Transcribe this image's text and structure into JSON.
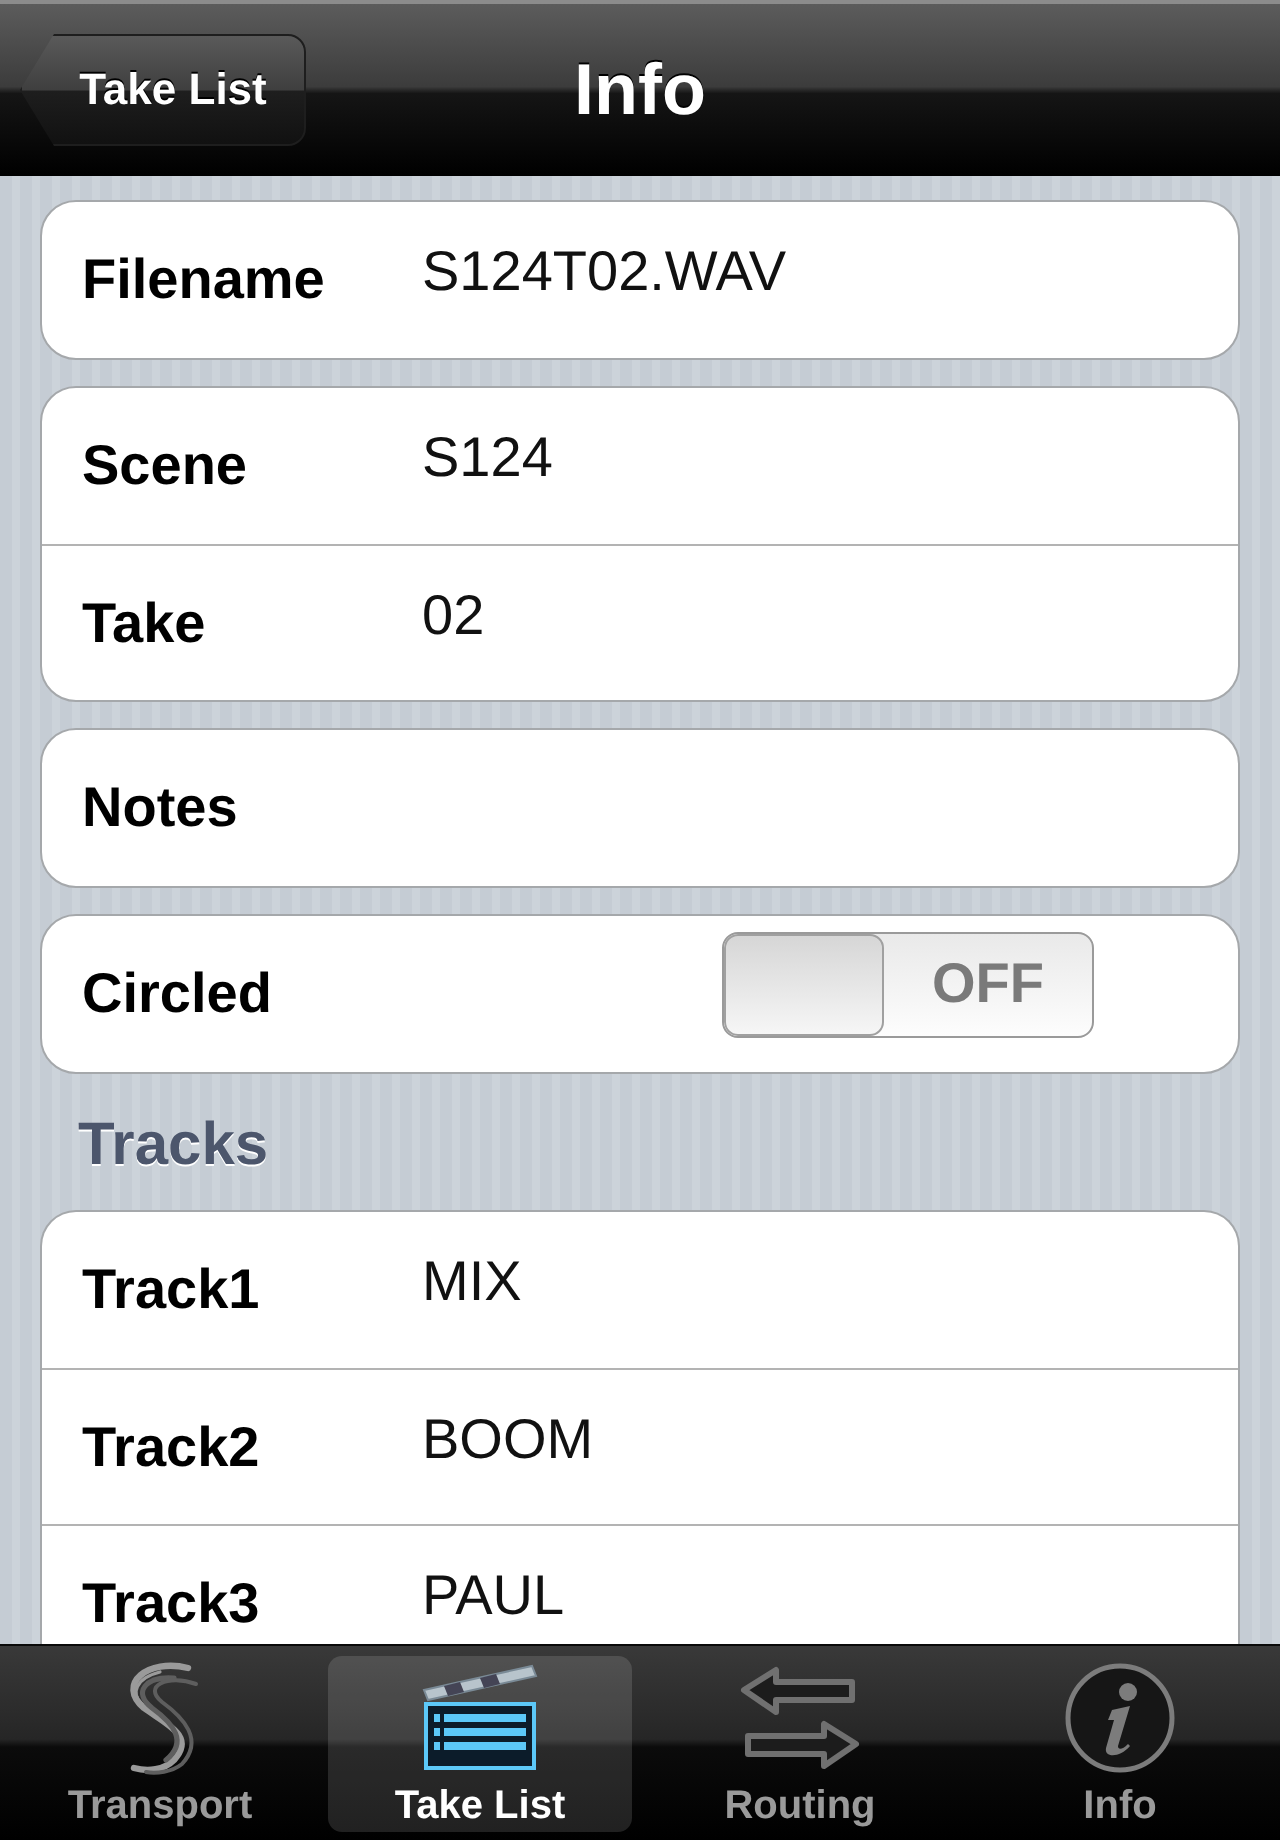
{
  "nav_bar": {
    "back_button": "Take List",
    "title": "Info"
  },
  "groups": [
    {
      "rows": [
        {
          "kind": "text",
          "label": "Filename",
          "value": "S124T02.WAV"
        }
      ]
    },
    {
      "rows": [
        {
          "kind": "text",
          "label": "Scene",
          "value": "S124"
        },
        {
          "kind": "text",
          "label": "Take",
          "value": "02"
        }
      ]
    },
    {
      "rows": [
        {
          "kind": "text",
          "label": "Notes"
        }
      ]
    },
    {
      "rows": [
        {
          "kind": "switch",
          "label": "Circled",
          "on": false,
          "switch_text": "OFF"
        }
      ]
    }
  ],
  "tracks_section": {
    "header": "Tracks",
    "rows": [
      {
        "kind": "text",
        "label": "Track1",
        "value": "MIX"
      },
      {
        "kind": "text",
        "label": "Track2",
        "value": "BOOM"
      },
      {
        "kind": "text",
        "label": "Track3",
        "value": "PAUL"
      }
    ]
  },
  "tab_bar": {
    "tabs": [
      {
        "label": "Transport",
        "selected": false
      },
      {
        "label": "Take List",
        "selected": true
      },
      {
        "label": "Routing",
        "selected": false
      },
      {
        "label": "Info",
        "selected": false
      }
    ]
  }
}
